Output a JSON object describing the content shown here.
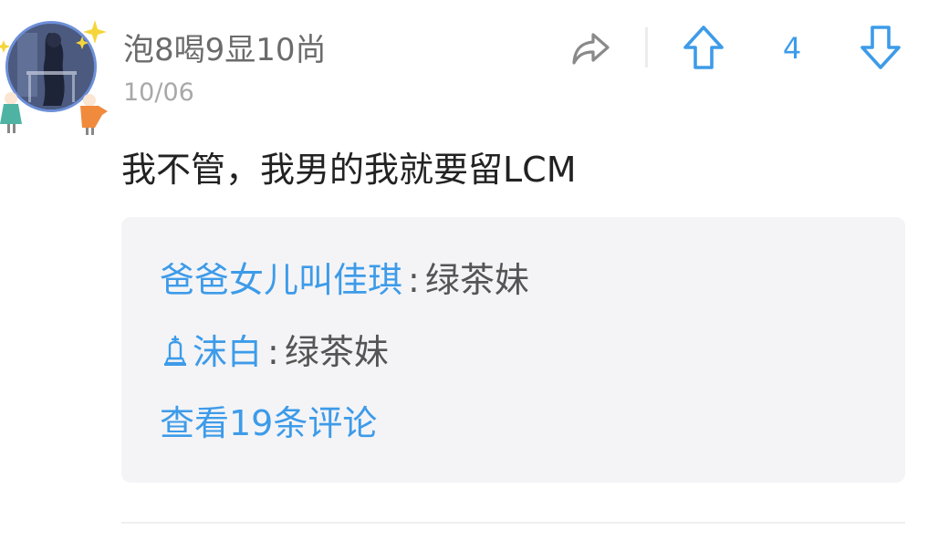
{
  "post": {
    "author": {
      "username": "泡8喝9显10尚",
      "avatar_icon": "user-avatar"
    },
    "date": "10/06",
    "actions": {
      "share_icon": "share-icon",
      "upvote_icon": "arrow-up-icon",
      "vote_count": "4",
      "downvote_icon": "arrow-down-icon"
    },
    "content": "我不管，我男的我就要留LCM",
    "replies": [
      {
        "user": "爸爸女儿叫佳琪",
        "separator": ":",
        "text": "绿茶妹",
        "badge": ""
      },
      {
        "user": "沫白",
        "separator": ":",
        "text": "绿茶妹",
        "badge": "bishop-badge-icon"
      }
    ],
    "view_all_label": "查看19条评论",
    "accent_color": "#3d9be9"
  }
}
